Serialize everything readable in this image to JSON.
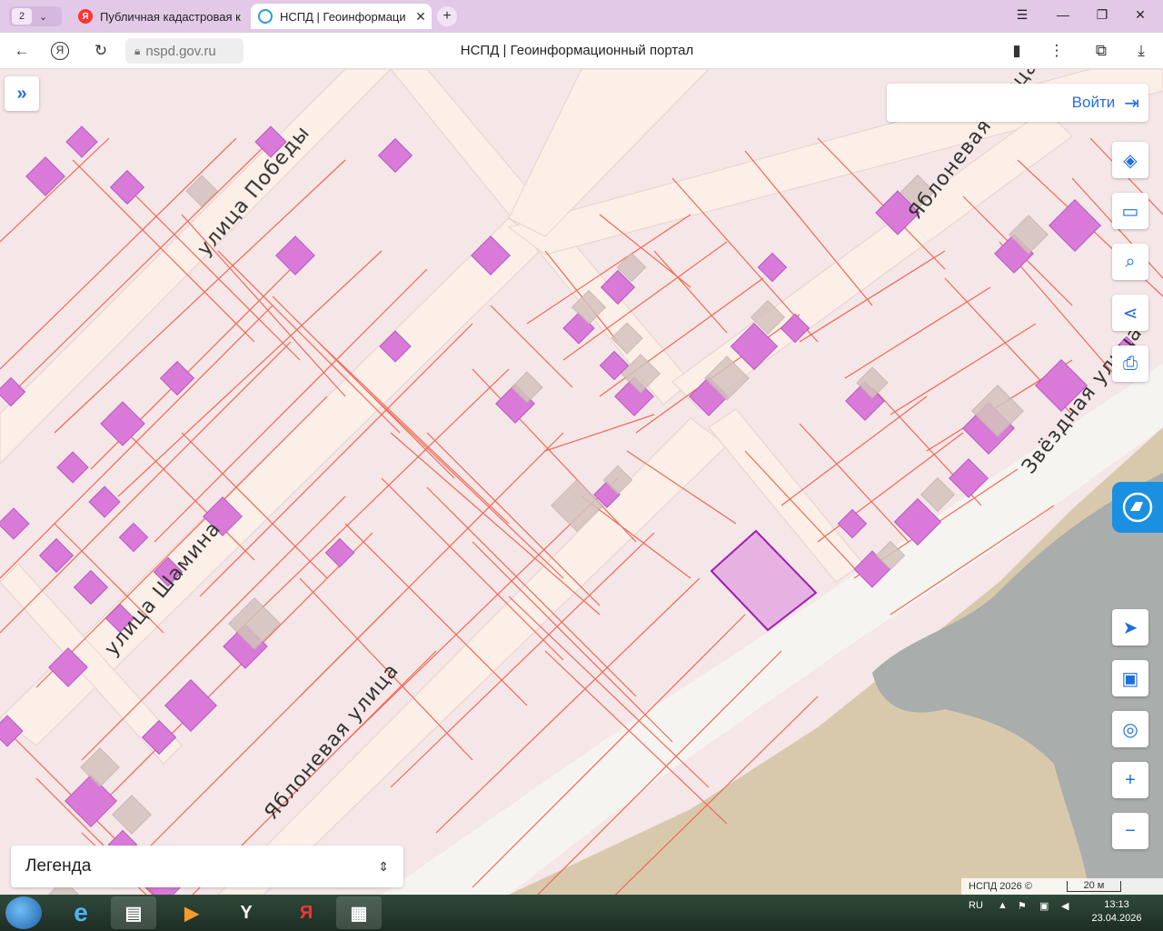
{
  "browser": {
    "tab_count": "2",
    "tabs": [
      {
        "title": "Публичная кадастровая к",
        "favicon": "Я"
      },
      {
        "title": "НСПД | Геоинформаци",
        "favicon": ""
      }
    ],
    "new_tab": "+",
    "url": "nspd.gov.ru",
    "page_title": "НСПД | Геоинформационный портал"
  },
  "map": {
    "streets": [
      {
        "name": "улица Победы"
      },
      {
        "name": "Яблоневая улица"
      },
      {
        "name": "Яблоневая улица"
      },
      {
        "name": "улица Шамина"
      },
      {
        "name": "Звёздная улица"
      }
    ],
    "login_label": "Войти",
    "legend_label": "Легенда",
    "attribution": "НСПД 2026 ©",
    "scale_label": "20 м",
    "colors": {
      "parcel_line": "#ef6a55",
      "building_fill": "#d97ad8",
      "selected_outline": "#a01fb0",
      "road": "#fbefe8",
      "water": "#a9adab",
      "sand": "#d9c9ac",
      "accent": "#1f6fd8"
    }
  },
  "taskbar": {
    "lang": "RU",
    "time": "13:13",
    "date": "23.04.2026"
  }
}
